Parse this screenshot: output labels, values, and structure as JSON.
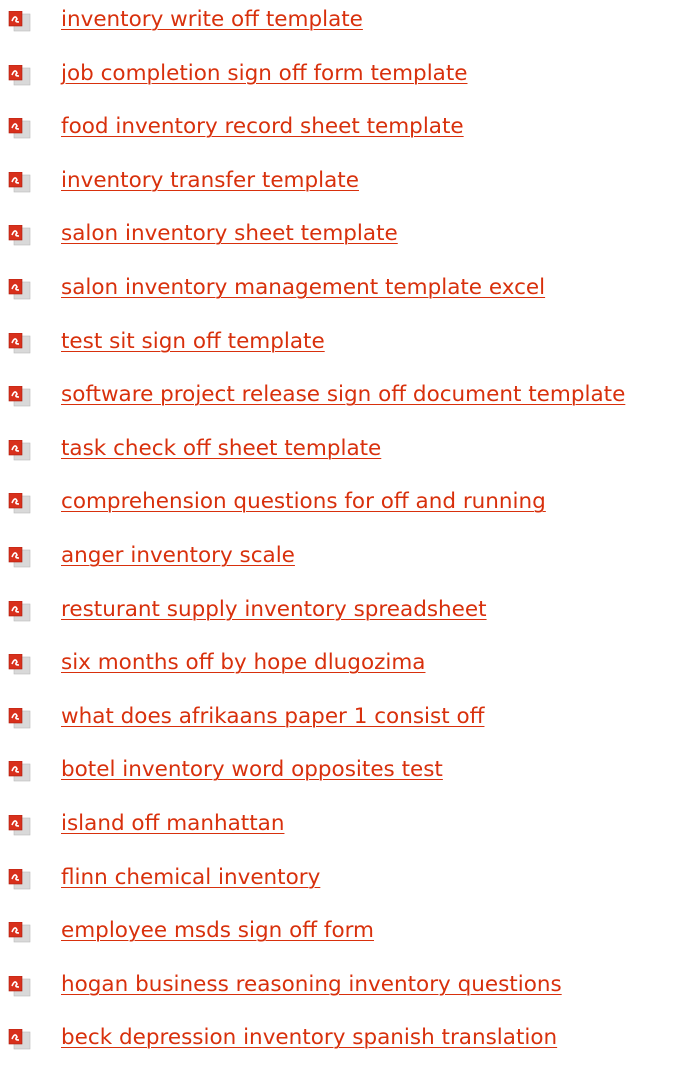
{
  "colors": {
    "link": "#d8300c",
    "background": "#ffffff",
    "icon_red": "#d8301c",
    "icon_paper": "#d4d4d4"
  },
  "icon": "pdf-document-icon",
  "links": [
    {
      "label": "inventory write off template"
    },
    {
      "label": "job completion sign off form template"
    },
    {
      "label": "food inventory record sheet template"
    },
    {
      "label": "inventory transfer template"
    },
    {
      "label": "salon inventory sheet template"
    },
    {
      "label": "salon inventory management template excel"
    },
    {
      "label": "test sit sign off template"
    },
    {
      "label": "software project release sign off document template"
    },
    {
      "label": "task check off sheet template"
    },
    {
      "label": "comprehension questions for off and running"
    },
    {
      "label": "anger inventory scale"
    },
    {
      "label": "resturant supply inventory spreadsheet"
    },
    {
      "label": "six months off by hope dlugozima"
    },
    {
      "label": "what does afrikaans paper 1 consist off"
    },
    {
      "label": "botel inventory word opposites test"
    },
    {
      "label": "island off manhattan"
    },
    {
      "label": "flinn chemical inventory"
    },
    {
      "label": "employee msds sign off form"
    },
    {
      "label": "hogan business reasoning inventory questions"
    },
    {
      "label": "beck depression inventory spanish translation"
    }
  ]
}
